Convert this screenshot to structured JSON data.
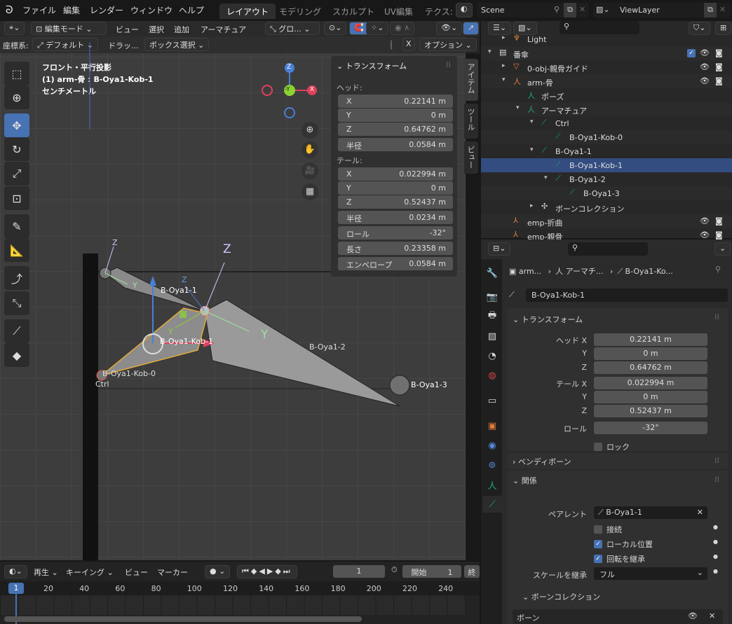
{
  "menu": [
    "ファイル",
    "編集",
    "レンダー",
    "ウィンドウ",
    "ヘルプ"
  ],
  "workspaces": [
    {
      "label": "レイアウト",
      "active": true
    },
    {
      "label": "モデリング"
    },
    {
      "label": "スカルプト"
    },
    {
      "label": "UV編集"
    },
    {
      "label": "テクス:"
    }
  ],
  "scene": "Scene",
  "view_layer": "ViewLayer",
  "viewport_header": {
    "mode": "編集モード",
    "menus": [
      "ビュー",
      "選択",
      "追加",
      "アーマチュア"
    ],
    "transform_orientation": "グロ...",
    "coord_label": "座標系:",
    "coord_value": "デフォルト",
    "drag_label": "ドラッ...",
    "select_mode": "ボックス選択",
    "x_label": "X",
    "options": "オプション"
  },
  "overlay_text": {
    "line1": "フロント・平行投影",
    "line2": "(1) arm-骨 : B-Oya1-Kob-1",
    "line3": "センチメートル"
  },
  "gizmo": {
    "z": "Z",
    "y": "-Y",
    "x": "X"
  },
  "bones_labels": {
    "b1": "B-Oya1-1",
    "kob1": "B-Oya1-Kob-1",
    "b2": "B-Oya1-2",
    "b3": "B-Oya1-3",
    "kob0": "B-Oya1-Kob-0",
    "ctrl": "Ctrl",
    "z": "Z",
    "y": "Y"
  },
  "npanel": {
    "title": "トランスフォーム",
    "head_label": "ヘッド:",
    "tail_label": "テール:",
    "head": [
      {
        "l": "X",
        "v": "0.22141 m"
      },
      {
        "l": "Y",
        "v": "0 m"
      },
      {
        "l": "Z",
        "v": "0.64762 m"
      }
    ],
    "head_radius": {
      "l": "半径",
      "v": "0.0584 m"
    },
    "tail": [
      {
        "l": "X",
        "v": "0.022994 m"
      },
      {
        "l": "Y",
        "v": "0 m"
      },
      {
        "l": "Z",
        "v": "0.52437 m"
      }
    ],
    "tail_radius": {
      "l": "半径",
      "v": "0.0234 m"
    },
    "roll": {
      "l": "ロール",
      "v": "-32°"
    },
    "length": {
      "l": "長さ",
      "v": "0.23358 m"
    },
    "envelope": {
      "l": "エンベロープ",
      "v": "0.0584 m"
    },
    "tabs": [
      "アイテム",
      "ツール",
      "ビュー"
    ]
  },
  "outliner": [
    {
      "label": "Light",
      "indent": 1
    },
    {
      "label": "番傘",
      "indent": 0,
      "vis": true
    },
    {
      "label": "0-obj-親骨ガイド",
      "indent": 1,
      "vis": true
    },
    {
      "label": "arm-骨",
      "indent": 1,
      "vis": true
    },
    {
      "label": "ポーズ",
      "indent": 2
    },
    {
      "label": "アーマチュア",
      "indent": 2
    },
    {
      "label": "Ctrl",
      "indent": 3
    },
    {
      "label": "B-Oya1-Kob-0",
      "indent": 4
    },
    {
      "label": "B-Oya1-1",
      "indent": 3
    },
    {
      "label": "B-Oya1-Kob-1",
      "indent": 4,
      "selected": true
    },
    {
      "label": "B-Oya1-2",
      "indent": 4
    },
    {
      "label": "B-Oya1-3",
      "indent": 5
    },
    {
      "label": "ボーンコレクション",
      "indent": 3
    },
    {
      "label": "emp-折曲",
      "indent": 1,
      "vis": true
    },
    {
      "label": "emp-親骨",
      "indent": 1,
      "vis": true
    }
  ],
  "props": {
    "breadcrumb": [
      "arm...",
      "アーマチ...",
      "B-Oya1-Ko..."
    ],
    "bone_name": "B-Oya1-Kob-1",
    "transform_title": "トランスフォーム",
    "head": [
      {
        "l": "ヘッド X",
        "v": "0.22141 m"
      },
      {
        "l": "Y",
        "v": "0 m"
      },
      {
        "l": "Z",
        "v": "0.64762 m"
      }
    ],
    "tail": [
      {
        "l": "テール X",
        "v": "0.022994 m"
      },
      {
        "l": "Y",
        "v": "0 m"
      },
      {
        "l": "Z",
        "v": "0.52437 m"
      }
    ],
    "roll": {
      "l": "ロール",
      "v": "-32°"
    },
    "lock": "ロック",
    "bendy": "ベンディボーン",
    "relations": "関係",
    "parent_label": "ペアレント",
    "parent": "B-Oya1-1",
    "connected": "接続",
    "local_location": "ローカル位置",
    "inherit_rotation": "回転を継承",
    "inherit_scale_label": "スケールを継承",
    "inherit_scale": "フル",
    "bone_collections": "ボーンコレクション",
    "bone_row": "ボーン",
    "checks": {
      "lock": false,
      "connected": false,
      "local_location": true,
      "inherit_rotation": true
    }
  },
  "timeline": {
    "menus": [
      "再生",
      "キーイング",
      "ビュー",
      "マーカー"
    ],
    "current_frame": "1",
    "start_label": "開始",
    "start": "1",
    "end_label": "終",
    "ticks": [
      "20",
      "40",
      "60",
      "80",
      "100",
      "120",
      "140",
      "160",
      "180",
      "200",
      "220",
      "240"
    ]
  },
  "colors": {
    "accent": "#4772b3",
    "bone": "#1fa67a",
    "selected_row": "#334d80",
    "x_axis": "#e0405a",
    "y_axis": "#8bd432",
    "z_axis": "#4a7fd6"
  }
}
